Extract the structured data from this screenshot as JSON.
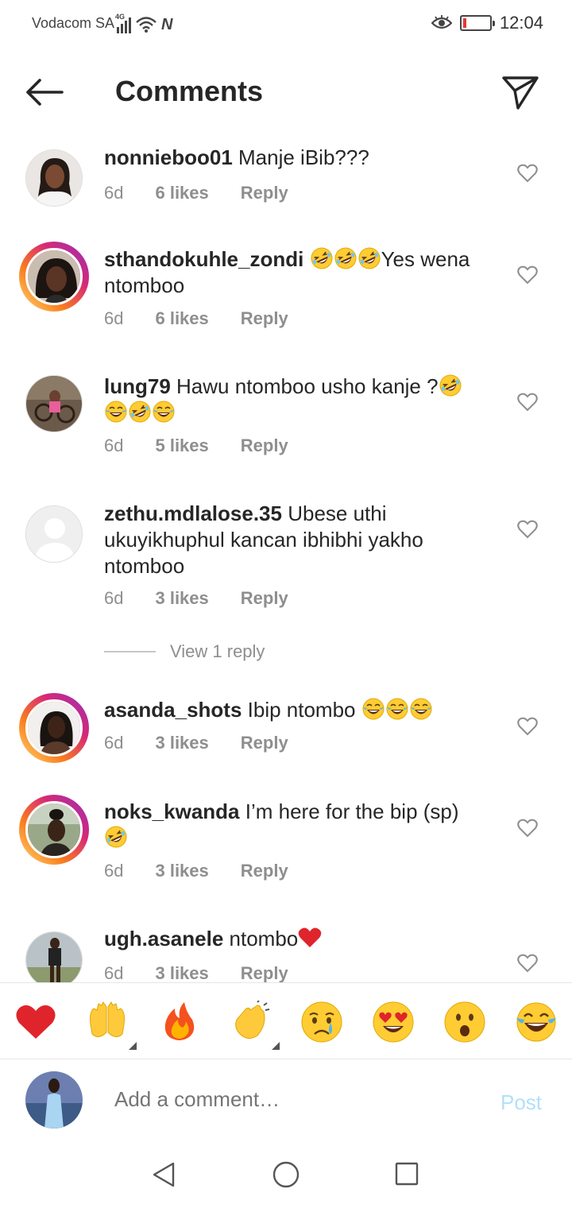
{
  "status": {
    "carrier": "Vodacom SA",
    "network": "4G",
    "time": "12:04"
  },
  "header": {
    "title": "Comments"
  },
  "comments": [
    {
      "user": "nonnieboo01",
      "text": "Manje iBib???",
      "time": "6d",
      "likes": "6 likes",
      "reply": "Reply"
    },
    {
      "user": "sthandokuhle_zondi",
      "text": "Yes wena ntomboo",
      "time": "6d",
      "likes": "6 likes",
      "reply": "Reply"
    },
    {
      "user": "lung79",
      "text": "Hawu ntomboo usho kanje ?",
      "time": "6d",
      "likes": "5 likes",
      "reply": "Reply"
    },
    {
      "user": "zethu.mdlalose.35",
      "text": "Ubese uthi ukuyikhuphul kancan ibhibhi yakho ntomboo",
      "time": "6d",
      "likes": "3 likes",
      "reply": "Reply"
    },
    {
      "user": "asanda_shots",
      "text": "Ibip ntombo",
      "time": "6d",
      "likes": "3 likes",
      "reply": "Reply"
    },
    {
      "user": "noks_kwanda",
      "text": "I’m here for the bip (sp)",
      "time": "6d",
      "likes": "3 likes",
      "reply": "Reply"
    },
    {
      "user": "ugh.asanele",
      "text": "ntombo",
      "time": "6d",
      "likes": "3 likes",
      "reply": "Reply"
    }
  ],
  "view_reply": "View 1 reply",
  "reactions": [
    "heart",
    "raised-hands",
    "fire",
    "clapping-hands",
    "crying-face",
    "heart-eyes",
    "surprised-face",
    "tears-of-joy"
  ],
  "composer": {
    "placeholder": "Add a comment…",
    "post_label": "Post"
  },
  "colors": {
    "text": "#262626",
    "muted": "#8e8e8e",
    "post_disabled": "#b2dffc",
    "heart_red": "#e0242b"
  }
}
